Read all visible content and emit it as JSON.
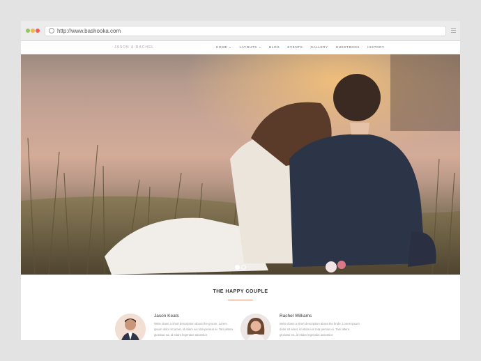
{
  "browser": {
    "url": "http://www.bashooka.com"
  },
  "site": {
    "brand": "JASON & RACHEL"
  },
  "nav": [
    {
      "label": "HOME ⌄"
    },
    {
      "label": "LAYOUTS ⌄"
    },
    {
      "label": "BLOG"
    },
    {
      "label": "EVENTS"
    },
    {
      "label": "GALLERY"
    },
    {
      "label": "GUESTBOOK"
    },
    {
      "label": "HISTORY"
    }
  ],
  "hero": {
    "slides": 2,
    "active": 1
  },
  "couple": {
    "title": "THE HAPPY COUPLE",
    "groom": {
      "name": "Jason Keats",
      "desc": "Write down a short description about the groom. Lorem ipsum dolor sit amet, id etiam ius tota persius ei. Tam altera gloriatur ea, id etiam legendos assentior."
    },
    "bride": {
      "name": "Rachel Williams",
      "desc": "Write down a short description about the bride. Lorem ipsum dolor sit amet, id etiam ius tota persius ei. Tam altera gloriatur ea, id etiam legendos assentior."
    }
  },
  "colors": {
    "accent": "#e4937a"
  }
}
